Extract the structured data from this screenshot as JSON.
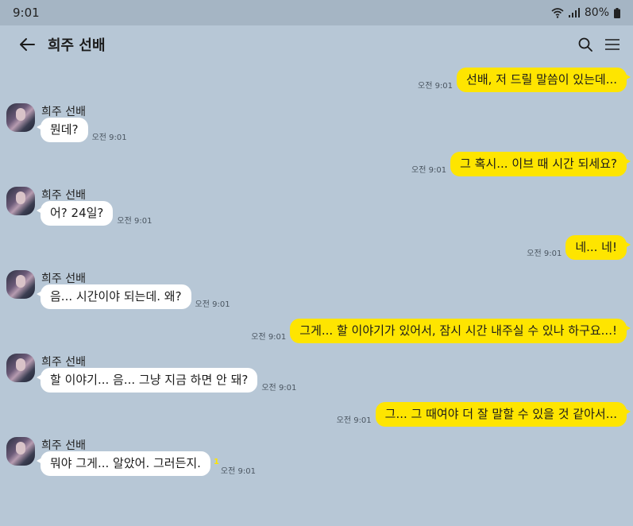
{
  "status": {
    "time": "9:01",
    "battery": "80%"
  },
  "header": {
    "title": "희주 선배"
  },
  "colors": {
    "background": "#b7c7d6",
    "outgoing": "#fee500",
    "incoming": "#ffffff"
  },
  "messages": [
    {
      "dir": "out",
      "text": "선배, 저 드릴 말씀이 있는데...",
      "time": "오전 9:01"
    },
    {
      "dir": "in",
      "sender": "희주 선배",
      "text": "뭔데?",
      "time": "오전 9:01"
    },
    {
      "dir": "out",
      "text": "그 혹시... 이브 때 시간 되세요?",
      "time": "오전 9:01"
    },
    {
      "dir": "in",
      "sender": "희주 선배",
      "text": "어? 24일?",
      "time": "오전 9:01"
    },
    {
      "dir": "out",
      "text": "네... 네!",
      "time": "오전 9:01"
    },
    {
      "dir": "in",
      "sender": "희주 선배",
      "text": "음... 시간이야 되는데. 왜?",
      "time": "오전 9:01"
    },
    {
      "dir": "out",
      "text": "그게... 할 이야기가 있어서, 잠시 시간 내주실 수 있나 하구요...!",
      "time": "오전 9:01"
    },
    {
      "dir": "in",
      "sender": "희주 선배",
      "text": "할 이야기... 음... 그냥 지금 하면 안 돼?",
      "time": "오전 9:01"
    },
    {
      "dir": "out",
      "text": "그... 그 때여야 더 잘 말할 수 있을 것 같아서...",
      "time": "오전 9:01"
    },
    {
      "dir": "in",
      "sender": "희주 선배",
      "text": "뭐야 그게... 알았어. 그러든지.",
      "time": "오전 9:01",
      "unread": "1"
    }
  ]
}
